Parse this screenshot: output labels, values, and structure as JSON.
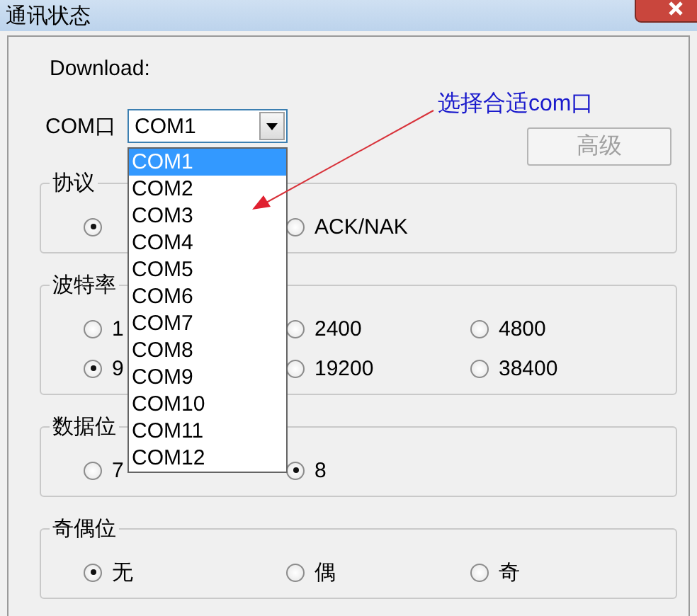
{
  "window": {
    "title": "通讯状态"
  },
  "download_label": "Download:",
  "com_port": {
    "label": "COM口",
    "value": "COM1",
    "expanded": true,
    "options": [
      {
        "label": "COM1",
        "selected": true
      },
      {
        "label": "COM2",
        "selected": false
      },
      {
        "label": "COM3",
        "selected": false
      },
      {
        "label": "COM4",
        "selected": false
      },
      {
        "label": "COM5",
        "selected": false
      },
      {
        "label": "COM6",
        "selected": false
      },
      {
        "label": "COM7",
        "selected": false
      },
      {
        "label": "COM8",
        "selected": false
      },
      {
        "label": "COM9",
        "selected": false
      },
      {
        "label": "COM10",
        "selected": false
      },
      {
        "label": "COM11",
        "selected": false
      },
      {
        "label": "COM12",
        "selected": false
      }
    ]
  },
  "advanced_button": {
    "label": "高级",
    "disabled": true
  },
  "annotation": {
    "text": "选择合适com口"
  },
  "groups": [
    {
      "title": "协议",
      "options": [
        {
          "selected": true
        },
        {
          "label": "ACK/NAK",
          "selected": false
        }
      ]
    },
    {
      "title": "波特率",
      "options": [
        {
          "label": "1",
          "selected": false
        },
        {
          "label": "2400",
          "selected": false
        },
        {
          "label": "4800",
          "selected": false
        },
        {
          "label": "9",
          "selected": true
        },
        {
          "label": "19200",
          "selected": false
        },
        {
          "label": "38400",
          "selected": false
        }
      ]
    },
    {
      "title": "数据位",
      "options": [
        {
          "label": "7",
          "selected": false
        },
        {
          "label": "8",
          "selected": true
        }
      ]
    },
    {
      "title": "奇偶位",
      "options": [
        {
          "label": "无",
          "selected": true
        },
        {
          "label": "偶",
          "selected": false
        },
        {
          "label": "奇",
          "selected": false
        }
      ]
    }
  ]
}
